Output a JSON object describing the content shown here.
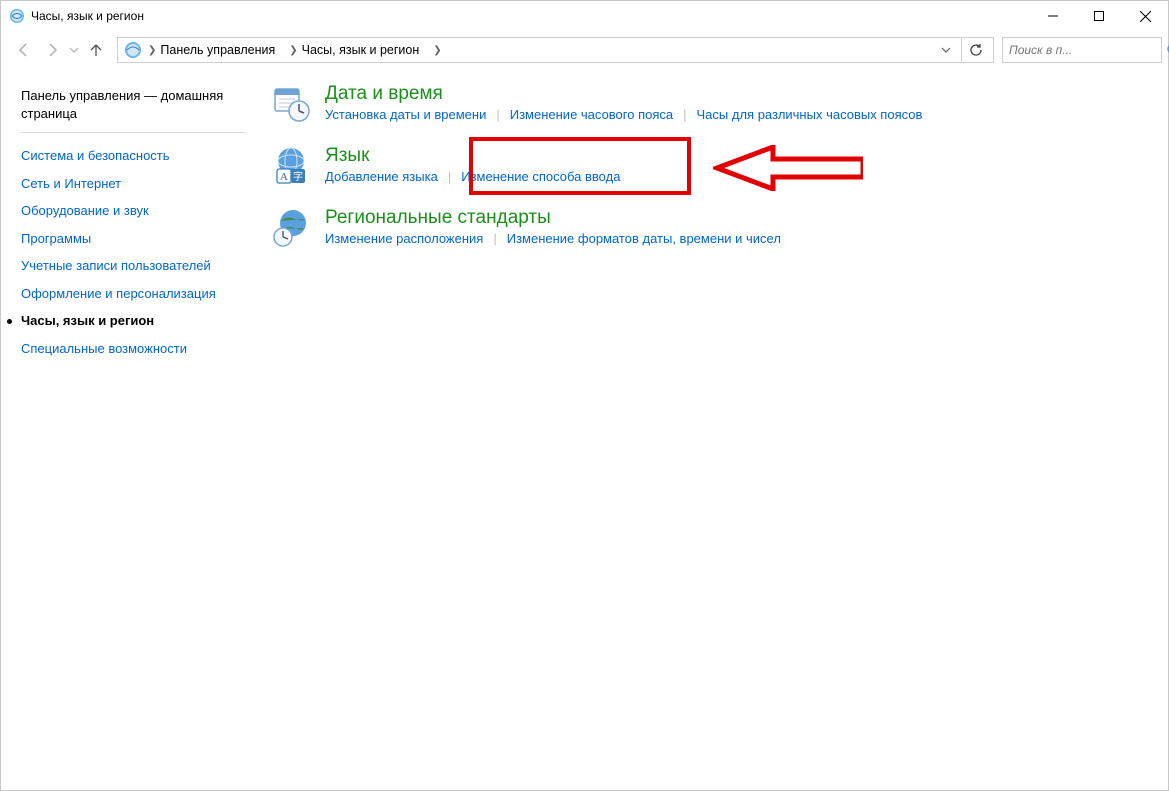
{
  "window": {
    "title": "Часы, язык и регион"
  },
  "breadcrumb": {
    "root": "Панель управления",
    "current": "Часы, язык и регион"
  },
  "search": {
    "placeholder": "Поиск в п..."
  },
  "sidebar": {
    "home": "Панель управления — домашняя страница",
    "items": [
      {
        "label": "Система и безопасность"
      },
      {
        "label": "Сеть и Интернет"
      },
      {
        "label": "Оборудование и звук"
      },
      {
        "label": "Программы"
      },
      {
        "label": "Учетные записи пользователей"
      },
      {
        "label": "Оформление и персонализация"
      },
      {
        "label": "Часы, язык и регион",
        "active": true
      },
      {
        "label": "Специальные возможности"
      }
    ]
  },
  "categories": {
    "datetime": {
      "title": "Дата и время",
      "tasks": [
        "Установка даты и времени",
        "Изменение часового пояса",
        "Часы для различных часовых поясов"
      ]
    },
    "language": {
      "title": "Язык",
      "tasks": [
        "Добавление языка",
        "Изменение способа ввода"
      ]
    },
    "region": {
      "title": "Региональные стандарты",
      "tasks": [
        "Изменение расположения",
        "Изменение форматов даты, времени и чисел"
      ]
    }
  }
}
